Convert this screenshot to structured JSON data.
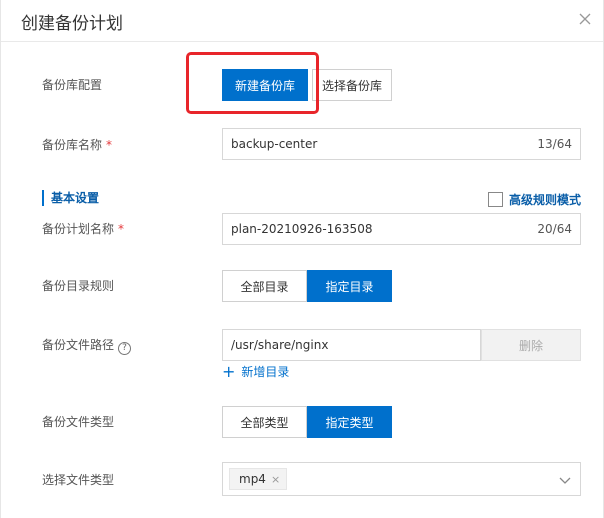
{
  "dialog": {
    "title": "创建备份计划",
    "close_icon": "close-icon"
  },
  "repo_config": {
    "label": "备份库配置",
    "new_repo_button": "新建备份库",
    "select_repo_button": "选择备份库"
  },
  "repo_name": {
    "label": "备份库名称",
    "required_mark": "*",
    "value": "backup-center",
    "count": "13/64"
  },
  "basic_settings": {
    "title": "基本设置",
    "advanced_mode_label": "高级规则模式"
  },
  "plan_name": {
    "label": "备份计划名称",
    "required_mark": "*",
    "value": "plan-20210926-163508",
    "count": "20/64"
  },
  "dir_rule": {
    "label": "备份目录规则",
    "option_all": "全部目录",
    "option_specified": "指定目录"
  },
  "file_path": {
    "label": "备份文件路径",
    "help_glyph": "?",
    "value": "/usr/share/nginx",
    "delete_button": "删除",
    "add_link": "新增目录",
    "add_glyph": "+"
  },
  "file_type": {
    "label": "备份文件类型",
    "option_all": "全部类型",
    "option_specified": "指定类型"
  },
  "select_file_type": {
    "label": "选择文件类型",
    "tags": [
      "mp4"
    ],
    "tag_remove_glyph": "×"
  },
  "colors": {
    "primary": "#0070cc",
    "highlight": "#e8252a",
    "required": "#e4393c"
  }
}
